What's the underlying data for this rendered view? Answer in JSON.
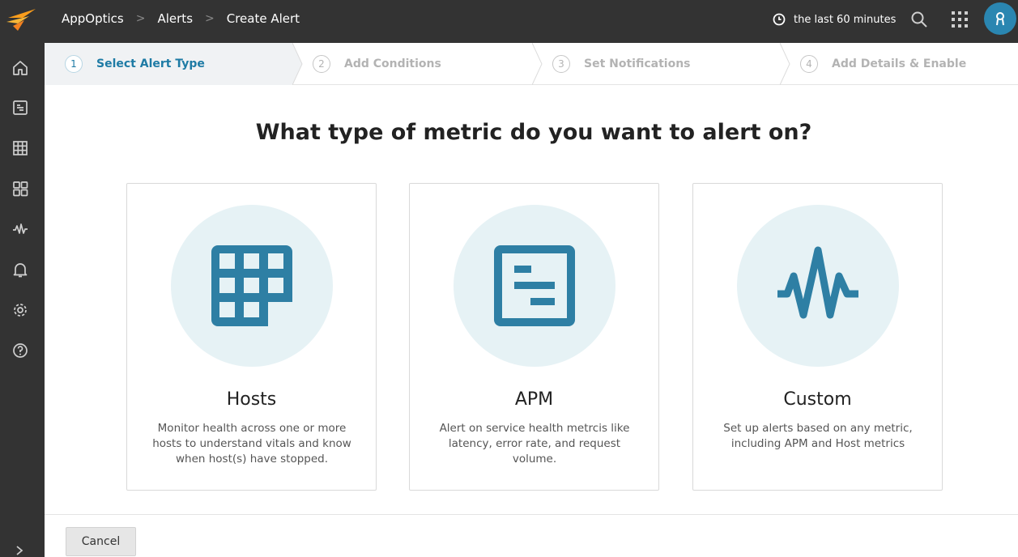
{
  "topbar": {
    "breadcrumbs": [
      "AppOptics",
      "Alerts",
      "Create Alert"
    ],
    "time_range": "the last 60 minutes",
    "accent_color": "#2a86b1"
  },
  "sidebar": {
    "items": [
      {
        "icon": "home-icon"
      },
      {
        "icon": "list-icon"
      },
      {
        "icon": "grid-icon"
      },
      {
        "icon": "dashboard-icon"
      },
      {
        "icon": "pulse-icon"
      },
      {
        "icon": "bell-icon"
      },
      {
        "icon": "gear-icon"
      },
      {
        "icon": "help-icon"
      }
    ]
  },
  "stepper": {
    "steps": [
      {
        "number": "1",
        "label": "Select Alert Type",
        "active": true
      },
      {
        "number": "2",
        "label": "Add Conditions",
        "active": false
      },
      {
        "number": "3",
        "label": "Set Notifications",
        "active": false
      },
      {
        "number": "4",
        "label": "Add Details & Enable",
        "active": false
      }
    ]
  },
  "main": {
    "question": "What type of metric do you want to alert on?",
    "cards": [
      {
        "icon": "hosts-grid-icon",
        "title": "Hosts",
        "description": "Monitor health across one or more hosts to understand vitals and know when host(s) have stopped."
      },
      {
        "icon": "apm-document-icon",
        "title": "APM",
        "description": "Alert on service health metrcis like latency, error rate, and request volume."
      },
      {
        "icon": "custom-pulse-icon",
        "title": "Custom",
        "description": "Set up alerts based on any metric, including APM and Host metrics"
      }
    ],
    "icon_color": "#2e7fa4",
    "circle_color": "#e6f2f5"
  },
  "footer": {
    "cancel_label": "Cancel"
  }
}
